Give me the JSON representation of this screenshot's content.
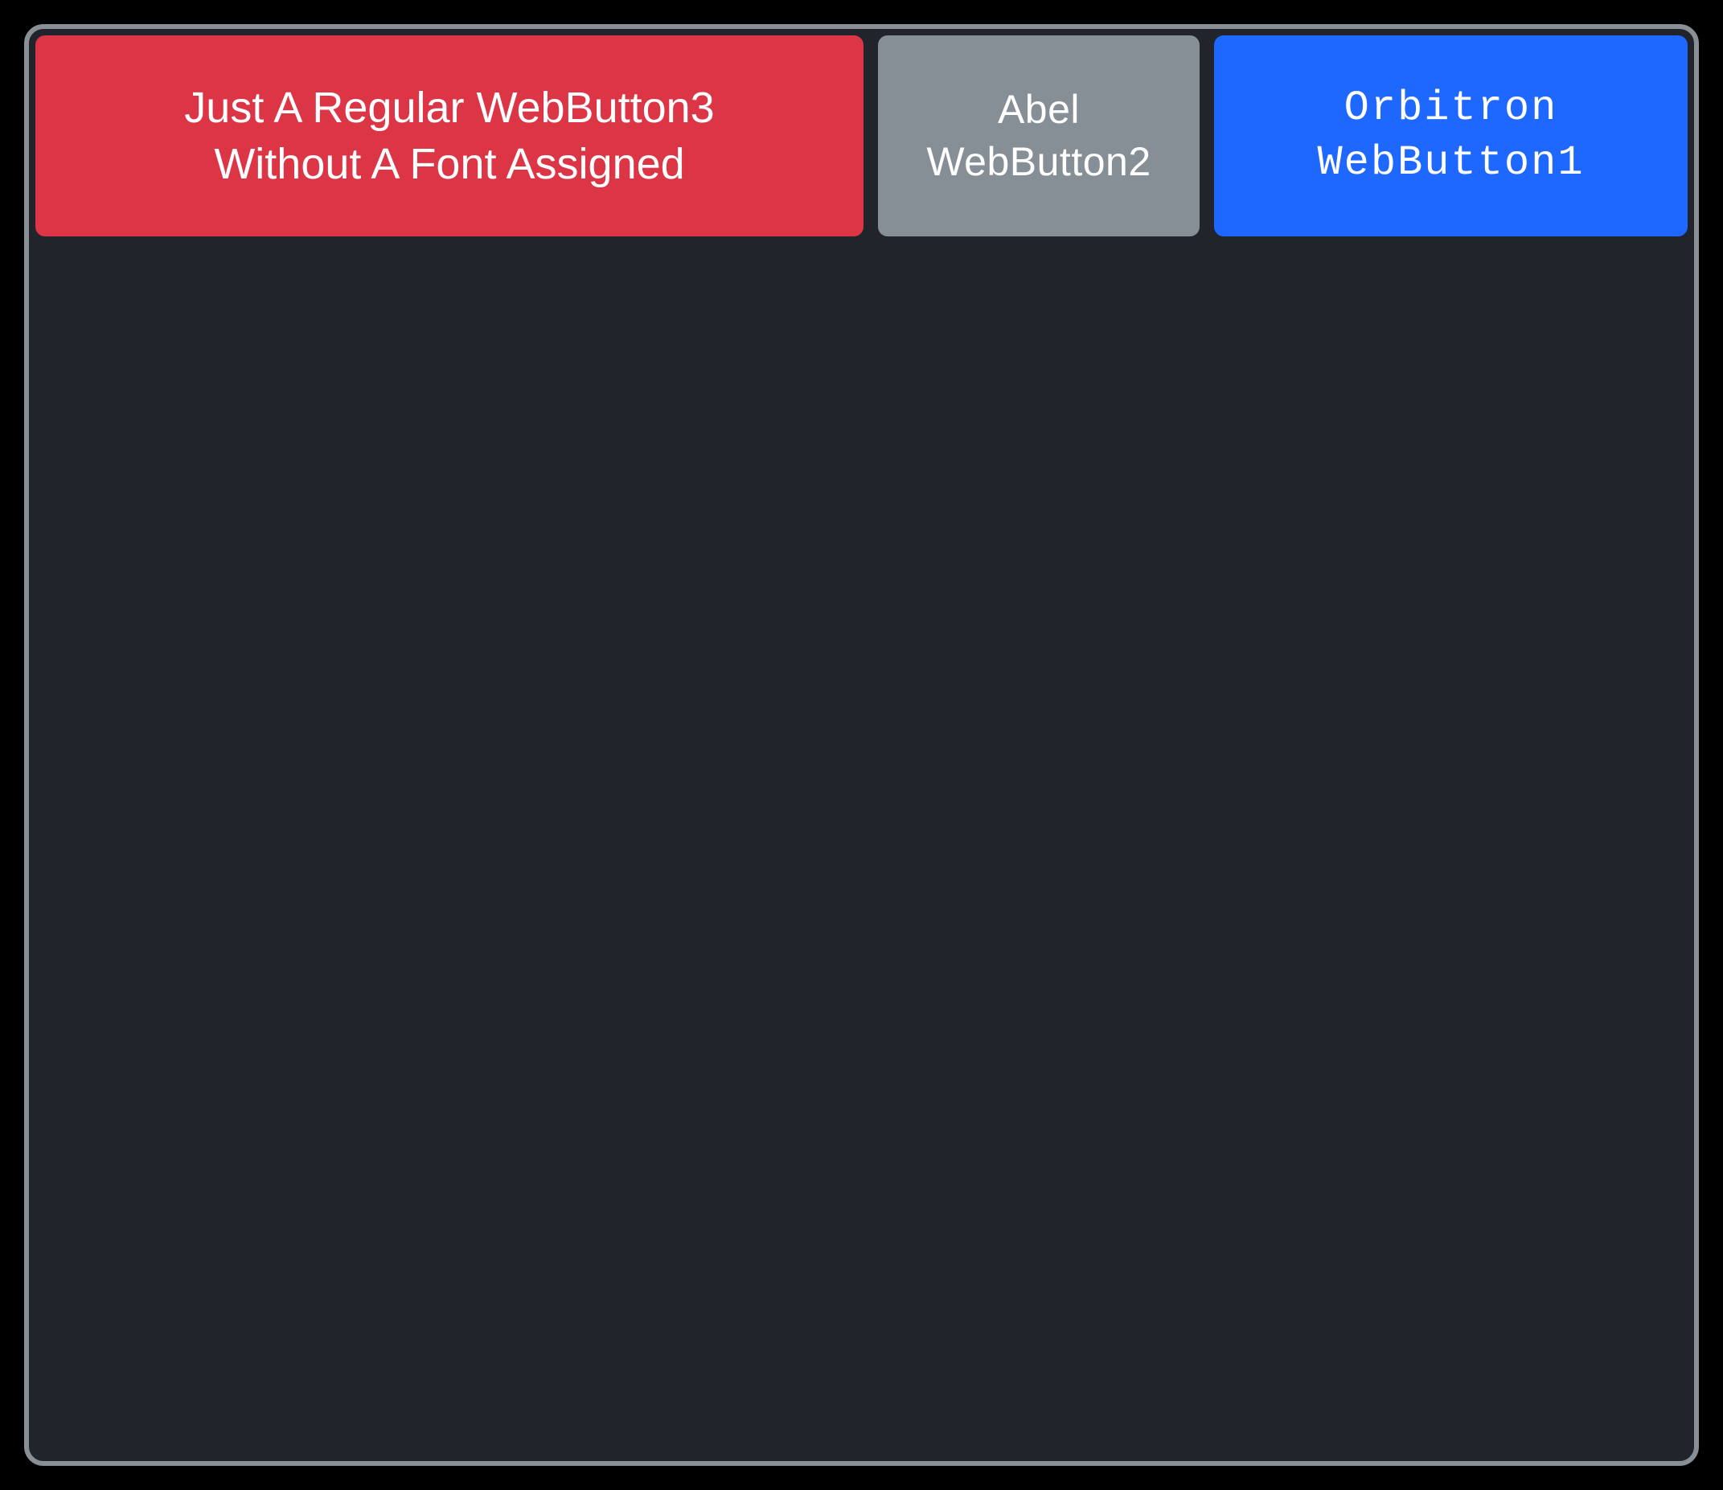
{
  "buttons": {
    "red": {
      "label": "Just A Regular WebButton3\nWithout A Font Assigned",
      "bg": "#dc3545"
    },
    "gray": {
      "label": "Abel\nWebButton2",
      "bg": "#868e96"
    },
    "blue": {
      "label": "Orbitron\nWebButton1",
      "bg": "#1e68ff"
    }
  },
  "panel": {
    "bg": "#21252b",
    "border": "#888f97"
  }
}
